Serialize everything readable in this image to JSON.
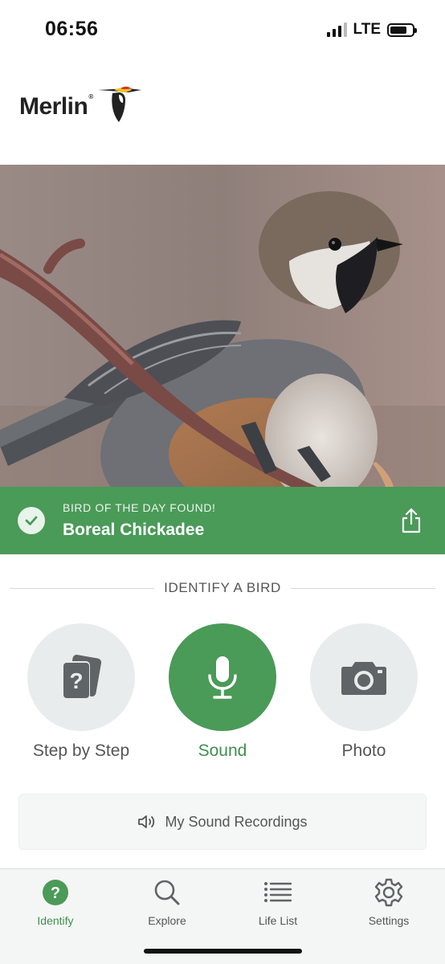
{
  "status_bar": {
    "time": "06:56",
    "network": "LTE"
  },
  "app": {
    "logo_text": "Merlin",
    "logo_mark": "®"
  },
  "bird_of_day": {
    "label": "BIRD OF THE DAY FOUND!",
    "species": "Boreal Chickadee",
    "icons": {
      "check": "check-icon",
      "share": "share-icon"
    }
  },
  "identify": {
    "heading": "IDENTIFY A BIRD",
    "options": [
      {
        "label": "Step by Step",
        "icon": "question-cards-icon",
        "active": false
      },
      {
        "label": "Sound",
        "icon": "microphone-icon",
        "active": true
      },
      {
        "label": "Photo",
        "icon": "camera-icon",
        "active": false
      }
    ],
    "recordings_label": "My Sound Recordings"
  },
  "tabs": [
    {
      "label": "Identify",
      "icon": "identify-icon",
      "active": true
    },
    {
      "label": "Explore",
      "icon": "search-icon",
      "active": false
    },
    {
      "label": "Life List",
      "icon": "list-icon",
      "active": false
    },
    {
      "label": "Settings",
      "icon": "gear-icon",
      "active": false
    }
  ],
  "colors": {
    "accent_green": "#4a9a58",
    "text_green": "#3f8f4d",
    "circle_gray": "#e9ecec",
    "icon_gray": "#5f6466"
  }
}
